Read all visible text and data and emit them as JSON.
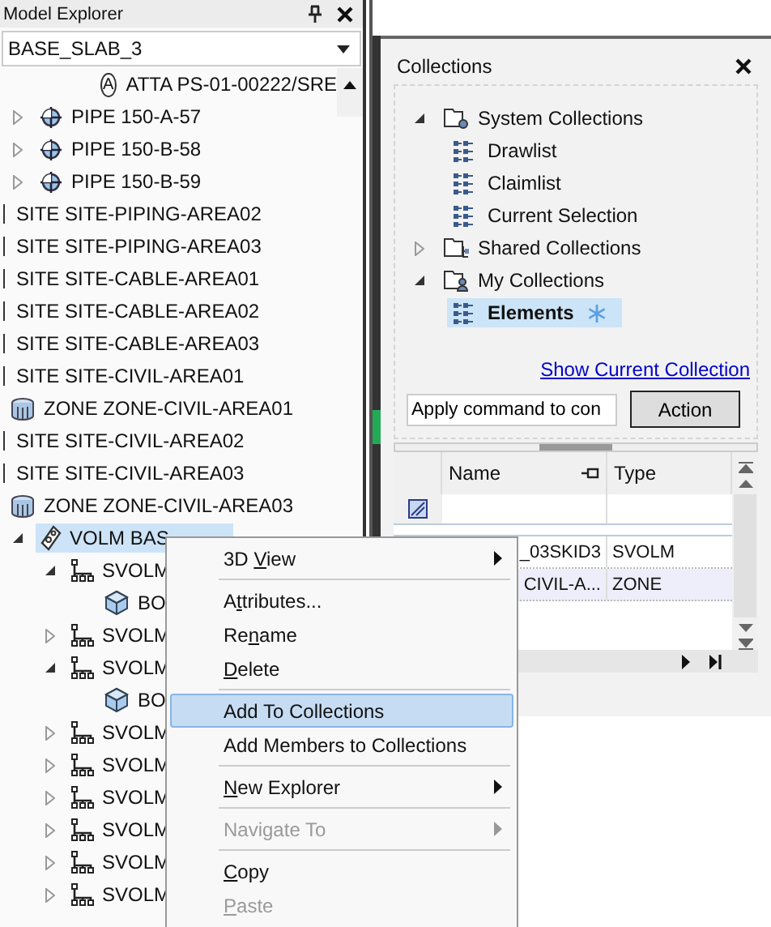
{
  "explorer": {
    "title": "Model Explorer",
    "combo_value": "BASE_SLAB_3",
    "top_row": {
      "badge": "A",
      "label": "ATTA PS-01-00222/SRE"
    },
    "items": [
      {
        "kind": "pipe",
        "label": "PIPE 150-A-57",
        "expandable": true,
        "expanded": false,
        "selected": false
      },
      {
        "kind": "pipe",
        "label": "PIPE 150-B-58",
        "expandable": true,
        "expanded": false,
        "selected": false
      },
      {
        "kind": "pipe",
        "label": "PIPE 150-B-59",
        "expandable": true,
        "expanded": false,
        "selected": false
      },
      {
        "kind": "site",
        "label": "SITE SITE-PIPING-AREA02",
        "expandable": false,
        "selected": false
      },
      {
        "kind": "site",
        "label": "SITE SITE-PIPING-AREA03",
        "expandable": false,
        "selected": false
      },
      {
        "kind": "site",
        "label": "SITE SITE-CABLE-AREA01",
        "expandable": false,
        "selected": false
      },
      {
        "kind": "site",
        "label": "SITE SITE-CABLE-AREA02",
        "expandable": false,
        "selected": false
      },
      {
        "kind": "site",
        "label": "SITE SITE-CABLE-AREA03",
        "expandable": false,
        "selected": false
      },
      {
        "kind": "site",
        "label": "SITE SITE-CIVIL-AREA01",
        "expandable": false,
        "selected": false
      },
      {
        "kind": "zone",
        "label": "ZONE ZONE-CIVIL-AREA01",
        "expandable": false,
        "selected": false
      },
      {
        "kind": "site",
        "label": "SITE SITE-CIVIL-AREA02",
        "expandable": false,
        "selected": false
      },
      {
        "kind": "site",
        "label": "SITE SITE-CIVIL-AREA03",
        "expandable": false,
        "selected": false
      },
      {
        "kind": "zone",
        "label": "ZONE ZONE-CIVIL-AREA03",
        "expandable": false,
        "selected": false
      },
      {
        "kind": "volm",
        "label": "VOLM BAS",
        "expandable": true,
        "expanded": true,
        "selected": true,
        "children": [
          {
            "kind": "svolm",
            "label": "SVOLM",
            "expandable": true,
            "expanded": true,
            "selected": false,
            "children": [
              {
                "kind": "box",
                "label": "BO",
                "expandable": false,
                "selected": false
              }
            ]
          },
          {
            "kind": "svolm",
            "label": "SVOLM",
            "expandable": true,
            "expanded": false,
            "selected": false
          },
          {
            "kind": "svolm",
            "label": "SVOLM",
            "expandable": true,
            "expanded": true,
            "selected": false,
            "children": [
              {
                "kind": "box",
                "label": "BO",
                "expandable": false,
                "selected": false
              }
            ]
          },
          {
            "kind": "svolm",
            "label": "SVOLM",
            "expandable": true,
            "expanded": false,
            "selected": false
          },
          {
            "kind": "svolm",
            "label": "SVOLM",
            "expandable": true,
            "expanded": false,
            "selected": false
          },
          {
            "kind": "svolm",
            "label": "SVOLM",
            "expandable": true,
            "expanded": false,
            "selected": false
          },
          {
            "kind": "svolm",
            "label": "SVOLM",
            "expandable": true,
            "expanded": false,
            "selected": false
          },
          {
            "kind": "svolm",
            "label": "SVOLM",
            "expandable": true,
            "expanded": false,
            "selected": false
          },
          {
            "kind": "svolm",
            "label": "SVOLM",
            "expandable": true,
            "expanded": false,
            "selected": false
          }
        ]
      }
    ]
  },
  "collections": {
    "title": "Collections",
    "tree": [
      {
        "kind": "system",
        "label": "System Collections",
        "expandable": true,
        "expanded": true,
        "selected": false,
        "children": [
          {
            "kind": "list",
            "label": "Drawlist",
            "expandable": false,
            "selected": false
          },
          {
            "kind": "list",
            "label": "Claimlist",
            "expandable": false,
            "selected": false
          },
          {
            "kind": "list",
            "label": "Current Selection",
            "expandable": false,
            "selected": false
          }
        ]
      },
      {
        "kind": "shared",
        "label": "Shared Collections",
        "expandable": true,
        "expanded": false,
        "selected": false
      },
      {
        "kind": "my",
        "label": "My Collections",
        "expandable": true,
        "expanded": true,
        "selected": false,
        "children": [
          {
            "kind": "list",
            "label": "Elements",
            "expandable": false,
            "selected": true,
            "modified": true
          }
        ]
      }
    ],
    "link": "Show Current Collection",
    "command_field": {
      "value": "Apply command to con"
    },
    "action_button": "Action",
    "grid": {
      "columns": [
        "Name",
        "Type"
      ],
      "rows": [
        {
          "name": "_03SKID3",
          "type": "SVOLM",
          "selected": false
        },
        {
          "name": "CIVIL-A...",
          "type": "ZONE",
          "selected": true
        }
      ]
    }
  },
  "context_menu": [
    {
      "kind": "item",
      "parts": [
        {
          "text": "3D ",
          "underline": false
        },
        {
          "text": "V",
          "underline": true
        },
        {
          "text": "iew",
          "underline": false
        }
      ],
      "submenu": true,
      "disabled": false,
      "selected": false
    },
    {
      "kind": "separator"
    },
    {
      "kind": "item",
      "parts": [
        {
          "text": "A",
          "underline": false
        },
        {
          "text": "t",
          "underline": true
        },
        {
          "text": "tributes...",
          "underline": false
        }
      ],
      "submenu": false,
      "disabled": false,
      "selected": false
    },
    {
      "kind": "item",
      "parts": [
        {
          "text": "Re",
          "underline": false
        },
        {
          "text": "n",
          "underline": true
        },
        {
          "text": "ame",
          "underline": false
        }
      ],
      "submenu": false,
      "disabled": false,
      "selected": false
    },
    {
      "kind": "item",
      "parts": [
        {
          "text": "D",
          "underline": true
        },
        {
          "text": "elete",
          "underline": false
        }
      ],
      "submenu": false,
      "disabled": false,
      "selected": false
    },
    {
      "kind": "separator"
    },
    {
      "kind": "item",
      "parts": [
        {
          "text": "Add To Collections",
          "underline": false
        }
      ],
      "submenu": false,
      "disabled": false,
      "selected": true
    },
    {
      "kind": "item",
      "parts": [
        {
          "text": "Add Members to Collections",
          "underline": false
        }
      ],
      "submenu": false,
      "disabled": false,
      "selected": false
    },
    {
      "kind": "separator"
    },
    {
      "kind": "item",
      "parts": [
        {
          "text": "N",
          "underline": true
        },
        {
          "text": "ew Explorer",
          "underline": false
        }
      ],
      "submenu": true,
      "disabled": false,
      "selected": false
    },
    {
      "kind": "separator"
    },
    {
      "kind": "item",
      "parts": [
        {
          "text": "Navigate To",
          "underline": false
        }
      ],
      "submenu": true,
      "disabled": true,
      "selected": false
    },
    {
      "kind": "separator"
    },
    {
      "kind": "item",
      "parts": [
        {
          "text": "C",
          "underline": true
        },
        {
          "text": "opy",
          "underline": false
        }
      ],
      "submenu": false,
      "disabled": false,
      "selected": false
    },
    {
      "kind": "item",
      "parts": [
        {
          "text": "P",
          "underline": true
        },
        {
          "text": "aste",
          "underline": false
        }
      ],
      "submenu": false,
      "disabled": true,
      "selected": false
    }
  ]
}
